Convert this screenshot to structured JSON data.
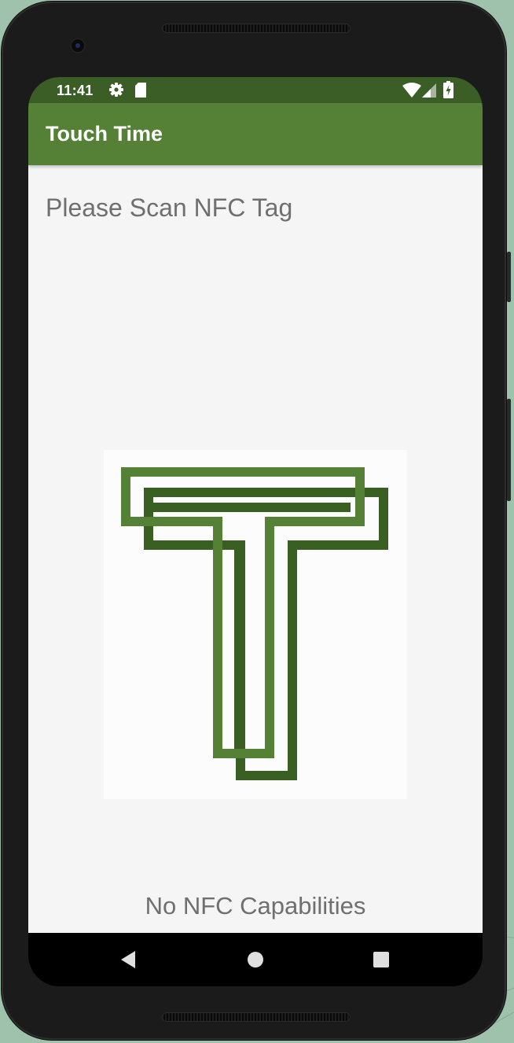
{
  "status_bar": {
    "time": "11:41",
    "icons": [
      "settings-gear-icon",
      "sd-card-icon",
      "wifi-icon",
      "cell-signal-icon",
      "battery-charging-icon"
    ]
  },
  "app_bar": {
    "title": "Touch Time"
  },
  "main": {
    "prompt": "Please Scan NFC Tag",
    "logo": "touch-time-t-logo",
    "nfc_status": "No NFC Capabilities"
  },
  "nav_bar": {
    "buttons": [
      "back-icon",
      "home-icon",
      "recents-icon"
    ]
  },
  "colors": {
    "primary": "#558136",
    "primary_dark": "#3b5e26",
    "logo_light": "#558136",
    "logo_dark": "#3a5f23",
    "text_secondary": "#6f6f6f",
    "background": "#f5f5f5"
  }
}
